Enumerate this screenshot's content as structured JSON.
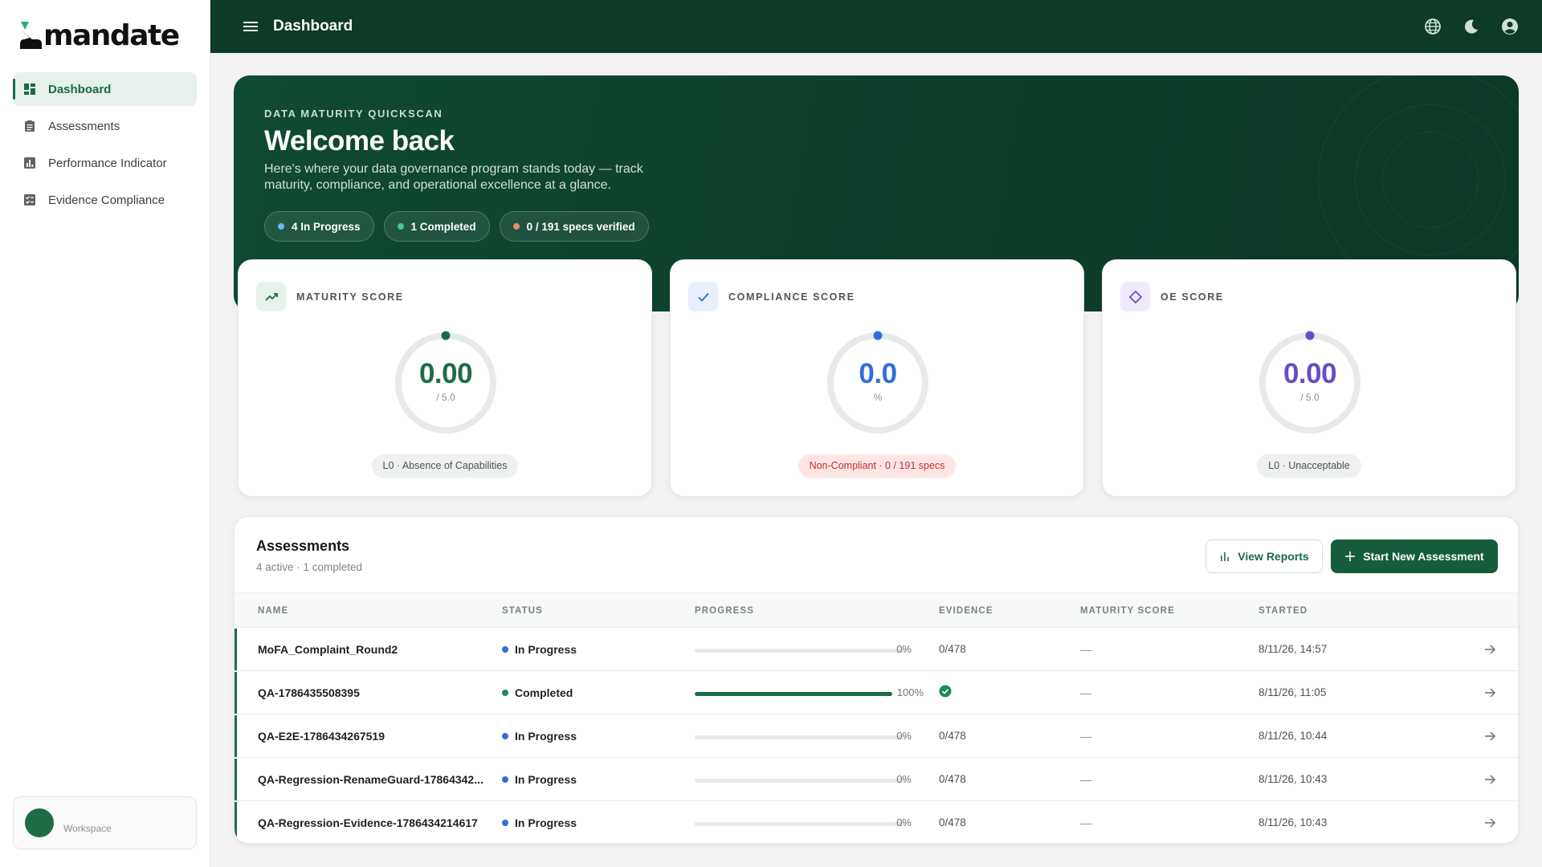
{
  "app": {
    "logo_text": "mandate",
    "page_title": "Dashboard",
    "colors": {
      "brand": "#0c3b28",
      "accent": "#1b6a47",
      "in_progress": "#2f6fdd",
      "completed": "#1d8a55",
      "non_compliant": "#c6302c",
      "oe": "#6a4bc7"
    }
  },
  "sidebar": {
    "items": [
      {
        "label": "Dashboard",
        "icon": "dashboard-icon",
        "active": true
      },
      {
        "label": "Assessments",
        "icon": "clipboard-icon",
        "active": false
      },
      {
        "label": "Performance Indicator",
        "icon": "bar-chart-icon",
        "active": false
      },
      {
        "label": "Evidence Compliance",
        "icon": "checklist-icon",
        "active": false
      }
    ],
    "workspace_label": "Workspace"
  },
  "topbar": {
    "icons": [
      "menu-icon",
      "globe-icon",
      "moon-icon",
      "account-icon"
    ]
  },
  "hero": {
    "kicker": "DATA MATURITY QUICKSCAN",
    "title": "Welcome back",
    "subtitle": "Here's where your data governance program stands today — track maturity, compliance, and operational excellence at a glance.",
    "pills": [
      {
        "label": "4 In Progress",
        "dot": "#6fb3f0"
      },
      {
        "label": "1 Completed",
        "dot": "#49c98a"
      },
      {
        "label": "0 / 191 specs verified",
        "dot": "#f08a6a"
      }
    ]
  },
  "scores": [
    {
      "label": "MATURITY SCORE",
      "value": "0.00",
      "unit": "/ 5.0",
      "badge": "L0 · Absence of Capabilities",
      "color": "#1d6c46",
      "fraction": 0
    },
    {
      "label": "COMPLIANCE SCORE",
      "value": "0.0",
      "unit": "%",
      "badge": "Non-Compliant · 0 / 191 specs",
      "color": "#2f6fdd",
      "fraction": 0
    },
    {
      "label": "OE SCORE",
      "value": "0.00",
      "unit": "/ 5.0",
      "badge": "L0 · Unacceptable",
      "color": "#6a4bc7",
      "fraction": 0
    }
  ],
  "assessments": {
    "title": "Assessments",
    "subtitle": "4 active · 1 completed",
    "view_reports": "View Reports",
    "start_new": "Start New Assessment",
    "columns": [
      "NAME",
      "STATUS",
      "PROGRESS",
      "EVIDENCE",
      "MATURITY SCORE",
      "STARTED"
    ],
    "rows": [
      {
        "name": "MoFA_Complaint_Round2",
        "status": "In Progress",
        "progress": 0,
        "progress_label": "0%",
        "evidence": "0/478",
        "maturity": "—",
        "started": "8/11/26, 14:57"
      },
      {
        "name": "QA-1786435508395",
        "status": "Completed",
        "progress": 100,
        "progress_label": "100%",
        "evidence": "",
        "maturity": "—",
        "started": "8/11/26, 11:05"
      },
      {
        "name": "QA-E2E-1786434267519",
        "status": "In Progress",
        "progress": 0,
        "progress_label": "0%",
        "evidence": "0/478",
        "maturity": "—",
        "started": "8/11/26, 10:44"
      },
      {
        "name": "QA-Regression-RenameGuard-17864342...",
        "status": "In Progress",
        "progress": 0,
        "progress_label": "0%",
        "evidence": "0/478",
        "maturity": "—",
        "started": "8/11/26, 10:43"
      },
      {
        "name": "QA-Regression-Evidence-1786434214617",
        "status": "In Progress",
        "progress": 0,
        "progress_label": "0%",
        "evidence": "0/478",
        "maturity": "—",
        "started": "8/11/26, 10:43"
      }
    ]
  }
}
